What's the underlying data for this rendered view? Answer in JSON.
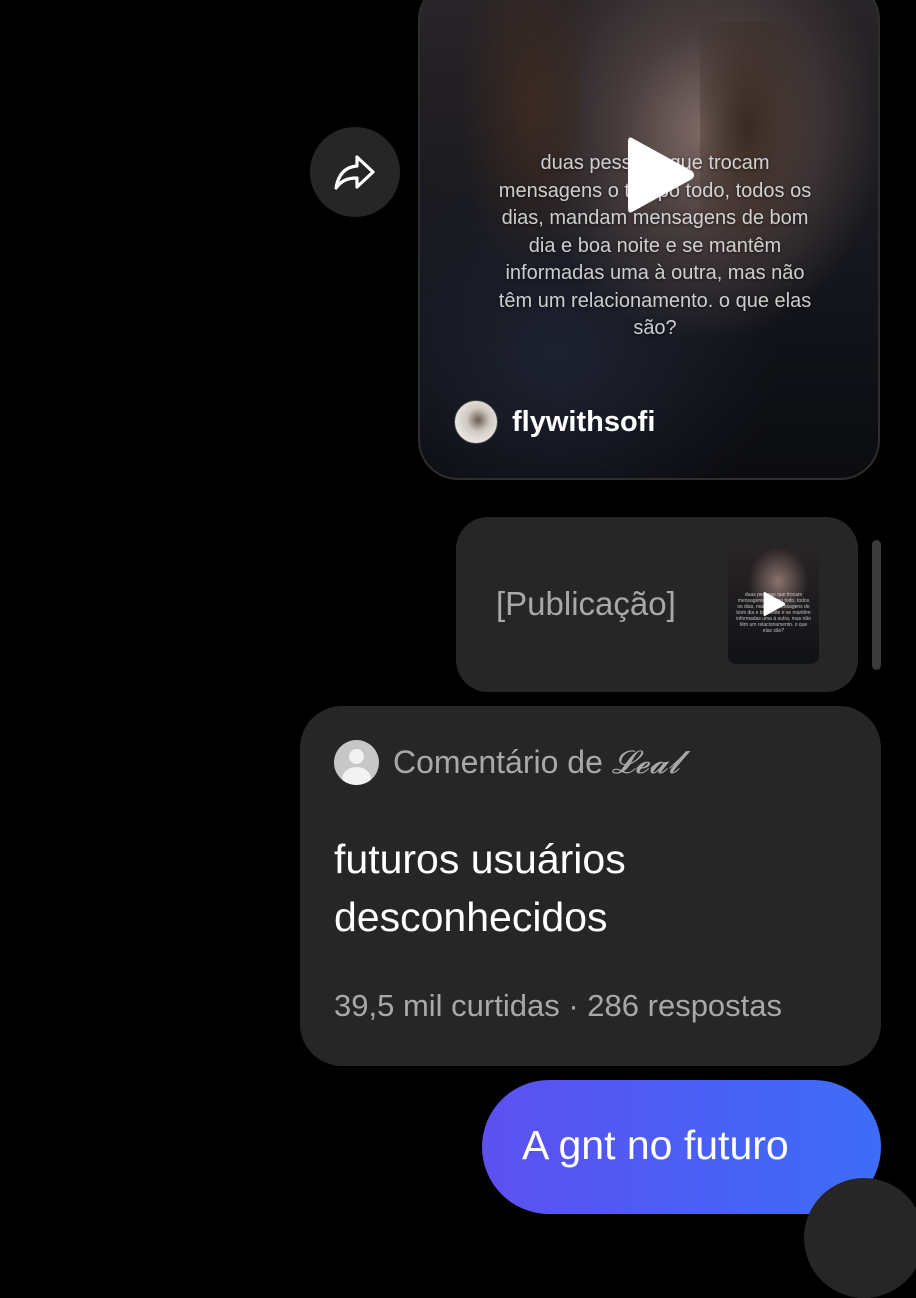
{
  "video_post": {
    "caption": "duas pessoas que trocam mensagens o tempo todo, todos os dias, mandam mensagens de bom dia e boa noite e se mantêm informadas uma à outra, mas não têm um relacionamento. o que elas são?",
    "author": "flywithsofi"
  },
  "publication": {
    "label": "[Publicação]"
  },
  "comment": {
    "header_prefix": "Comentário de",
    "handle": "𝓛𝓮𝓪𝓵",
    "text": "futuros usuários desconhecidos",
    "likes": "39,5 mil curtidas",
    "separator": "·",
    "replies": "286 respostas"
  },
  "sent_message": {
    "text": "A gnt no futuro",
    "gradient": [
      "#5d50f0",
      "#3e6df7"
    ]
  },
  "icons": {
    "share": "share-forward-icon",
    "play": "play-icon"
  }
}
